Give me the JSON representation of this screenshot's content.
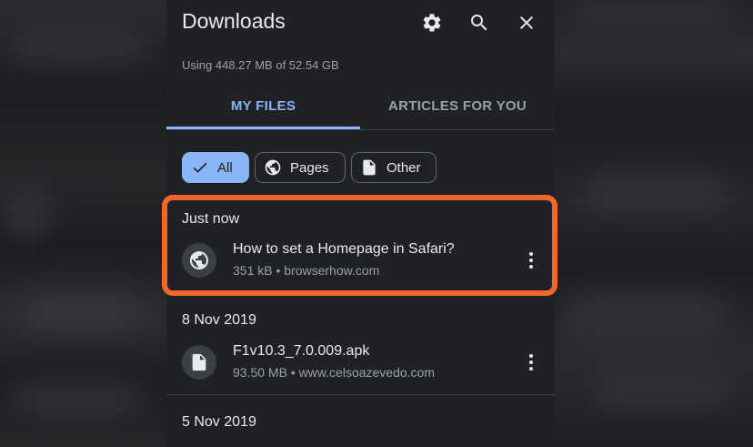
{
  "header": {
    "title": "Downloads",
    "usage": "Using 448.27 MB of 52.54 GB"
  },
  "icons": {
    "settings": "gear-icon",
    "search": "search-icon",
    "close": "close-icon"
  },
  "tabs": [
    {
      "label": "MY FILES",
      "selected": true
    },
    {
      "label": "ARTICLES FOR YOU",
      "selected": false
    }
  ],
  "filters": [
    {
      "label": "All",
      "icon": "check-icon",
      "selected": true
    },
    {
      "label": "Pages",
      "icon": "globe-icon",
      "selected": false
    },
    {
      "label": "Other",
      "icon": "file-icon",
      "selected": false
    }
  ],
  "sections": [
    {
      "heading": "Just now",
      "items": [
        {
          "title": "How to set a Homepage in Safari?",
          "meta": "351 kB • browserhow.com",
          "icon": "globe-icon"
        }
      ]
    },
    {
      "heading": "8 Nov 2019",
      "items": [
        {
          "title": "F1v10.3_7.0.009.apk",
          "meta": "93.50 MB • www.celsoazevedo.com",
          "icon": "file-icon"
        }
      ]
    },
    {
      "heading": "5 Nov 2019",
      "items": []
    }
  ],
  "colors": {
    "accent": "#8ab4f8",
    "highlight": "#f0662c",
    "background": "#202124"
  }
}
